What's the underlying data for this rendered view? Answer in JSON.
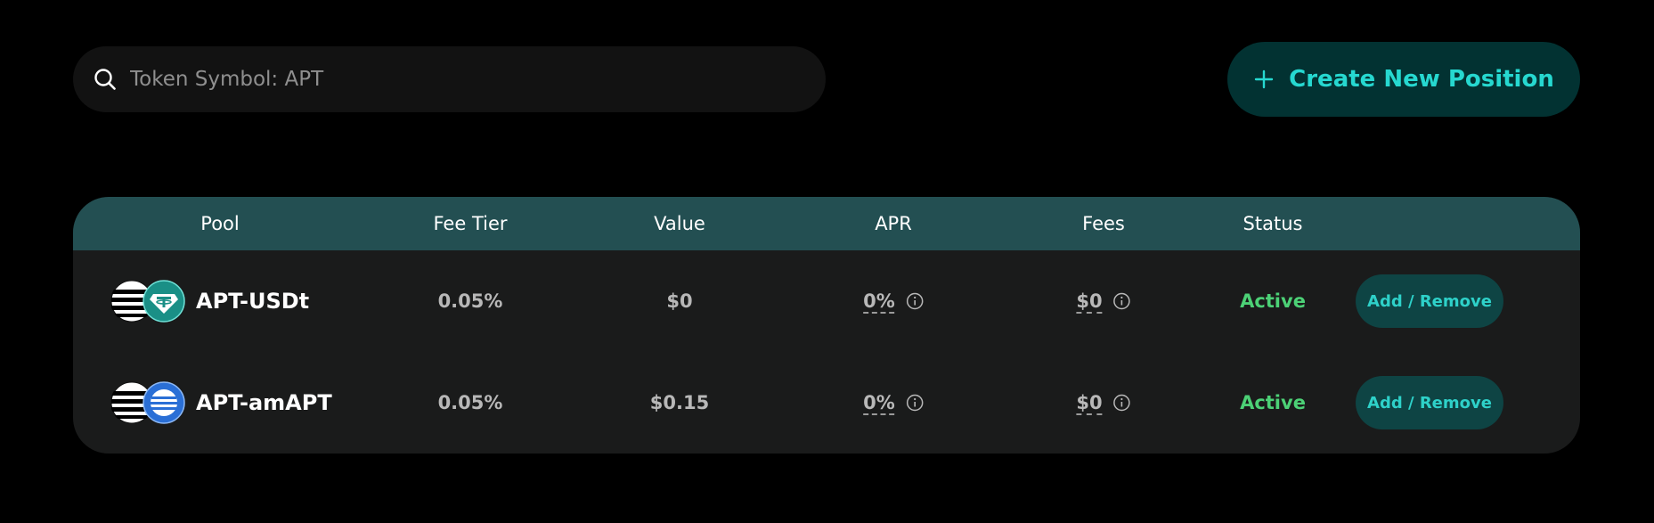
{
  "search": {
    "placeholder": "Token Symbol: APT",
    "value": ""
  },
  "create_button": {
    "label": "Create New Position"
  },
  "table": {
    "columns": [
      "Pool",
      "Fee Tier",
      "Value",
      "APR",
      "Fees",
      "Status"
    ],
    "rows": [
      {
        "pool": "APT-USDt",
        "fee_tier": "0.05%",
        "value": "$0",
        "apr": "0%",
        "fees": "$0",
        "status": "Active",
        "action": "Add / Remove",
        "token_b_icon": "usdt-icon"
      },
      {
        "pool": "APT-amAPT",
        "fee_tier": "0.05%",
        "value": "$0.15",
        "apr": "0%",
        "fees": "$0",
        "status": "Active",
        "action": "Add / Remove",
        "token_b_icon": "amapt-icon"
      }
    ]
  },
  "colors": {
    "background": "#000000",
    "accent": "#26d8d0",
    "header_bg": "#234f52",
    "active_status": "#4cd176",
    "button_bg": "#0e4444"
  }
}
